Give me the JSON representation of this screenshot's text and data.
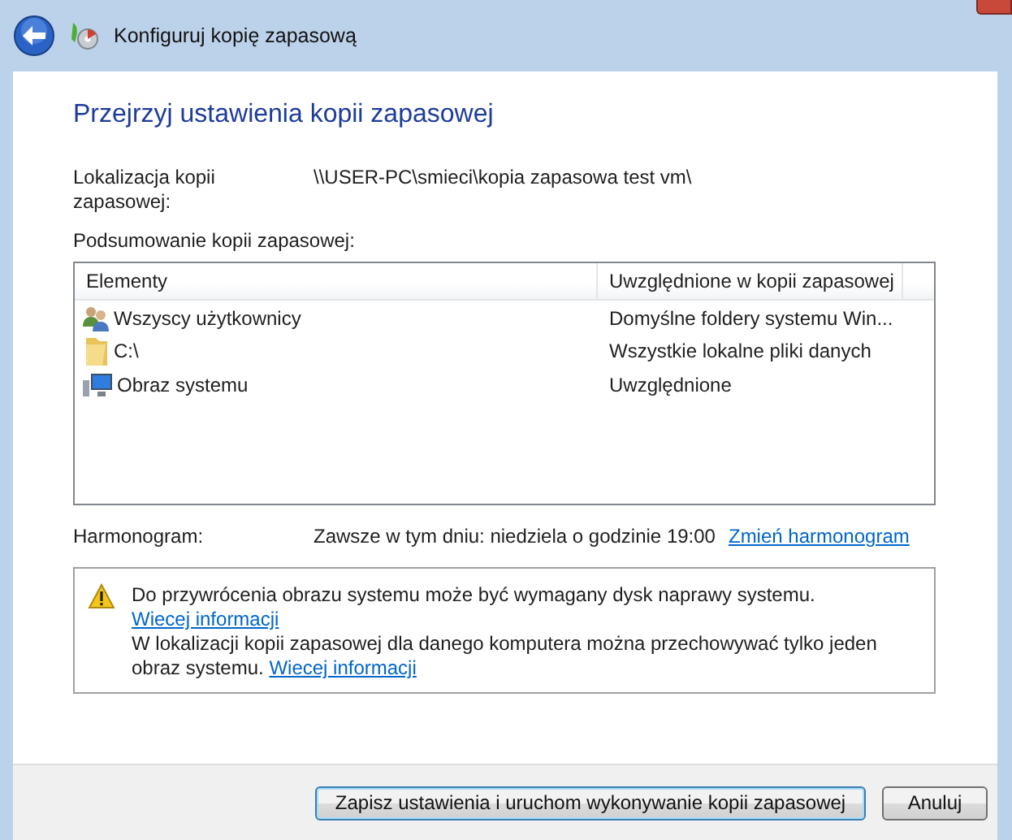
{
  "window": {
    "title": "Konfiguruj kopię zapasową"
  },
  "heading": "Przejrzyj ustawienia kopii zapasowej",
  "location": {
    "label": "Lokalizacja kopii zapasowej:",
    "value": "\\\\USER-PC\\smieci\\kopia zapasowa test vm\\"
  },
  "summary": {
    "label": "Podsumowanie kopii zapasowej:",
    "columns": [
      "Elementy",
      "Uwzględnione w kopii zapasowej"
    ],
    "rows": [
      {
        "kind": "users",
        "name": "Wszyscy użytkownicy",
        "included": "Domyślne foldery systemu Win..."
      },
      {
        "kind": "folder",
        "name": "C:\\",
        "included": "Wszystkie lokalne pliki danych"
      },
      {
        "kind": "computer",
        "name": "Obraz systemu",
        "included": "Uwzględnione"
      }
    ]
  },
  "schedule": {
    "label": "Harmonogram:",
    "value": "Zawsze w tym dniu: niedziela o godzinie 19:00",
    "link": "Zmień harmonogram"
  },
  "notice": {
    "messages": [
      {
        "text": "Do przywrócenia obrazu systemu może być wymagany dysk naprawy systemu.",
        "link": "Wiecej informacji"
      },
      {
        "text": "W lokalizacji kopii zapasowej dla danego komputera można przechowywać tylko jeden obraz systemu.",
        "link": "Wiecej informacji"
      }
    ]
  },
  "buttons": [
    {
      "kind": "primary",
      "label": "Zapisz ustawienia i uruchom wykonywanie kopii zapasowej"
    },
    {
      "kind": "normal",
      "label": "Anuluj"
    }
  ]
}
